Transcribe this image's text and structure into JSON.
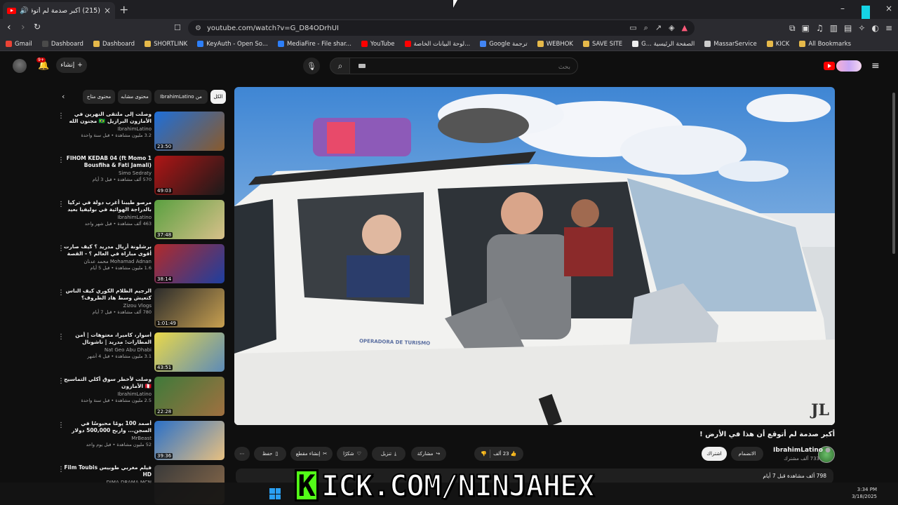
{
  "browser": {
    "tab_title": "(215) أكبر صدمة لم أتوقع أن هـ",
    "url": "youtube.com/watch?v=G_D84ODrhUI",
    "bookmarks": [
      "Gmail",
      "Dashboard",
      "Dashboard",
      "SHORTLINK",
      "KeyAuth - Open So...",
      "MediaFire - File shar...",
      "YouTube",
      "لوحة البيانات الخاصة...",
      "Google ترجمة",
      "WEBHOK",
      "SAVE SITE",
      "G... الصفحة الرئيسية",
      "MassarService",
      "KICK",
      "All Bookmarks"
    ],
    "bookmark_colors": [
      "#ea4335",
      "#4a4a4a",
      "#e6b94a",
      "#e6b94a",
      "#2d7ff9",
      "#2d7ff9",
      "#ff0000",
      "#ff0000",
      "#4285f4",
      "#e6b94a",
      "#e6b94a",
      "#eeeeee",
      "#cccccc",
      "#e6b94a",
      "#e6b94a"
    ]
  },
  "header": {
    "search_placeholder": "بحث",
    "create_label": "إنشاء",
    "notif_count": "9+"
  },
  "video": {
    "title": "أكبر صدمة لم أتوقع أن هذا في الأرض !",
    "door_text": "OPERADORA DE TURISMO",
    "watermark": "JL",
    "channel": "IbrahimLatino",
    "subs": "733 ألف مشترك",
    "join": "الانضمام",
    "subscribe": "اشتراك",
    "likes": "23 ألف",
    "share": "مشاركة",
    "download": "تنزيل",
    "thanks": "شكرًا",
    "clip": "إنشاء مقطع",
    "save": "حفظ",
    "views_meta": "798 ألف مشاهدة قبل 7 أيام"
  },
  "chips": [
    "الكل",
    "من IbrahimLatino",
    "محتوى مشابه",
    "محتوى متاح"
  ],
  "recs": [
    {
      "title": "وصلت إلى ملتقى النهرين في الأمازون البرازيل 🇧🇷 مجنون الله",
      "channel": "IbrahimLatino",
      "meta": "3.2 مليون مشاهدة • قبل سنة واحدة",
      "dur": "23:50",
      "c1": "#1e6fd9",
      "c2": "#8a5a2b"
    },
    {
      "title": "1 FIHOM KEDAB 04 (ft Momo Bousfiha & Fati Jamali)",
      "channel": "Simo Sedraty",
      "meta": "570 ألف مشاهدة • قبل 3 أيام",
      "dur": "49:03",
      "c1": "#b01515",
      "c2": "#1a1a1a"
    },
    {
      "title": "مرصو طيبنا أغرب دولة في تركيا بالدراجة الهوائية في بوليفيا بعيد عن البحر 🇧🇴",
      "channel": "IbrahimLatino",
      "meta": "463 ألف مشاهدة • قبل شهر واحد",
      "dur": "37:48",
      "c1": "#5aa040",
      "c2": "#d8c08a"
    },
    {
      "title": "برشلونة أريال مدريد ؟ كيف صارت أقوى مباراة في العالم ؟ - القصة الكاملة",
      "channel": "Mohamad Adnan محمد عدنان",
      "meta": "1.6 مليون مشاهدة • قبل 5 أيام",
      "dur": "38:14",
      "c1": "#b22a2a",
      "c2": "#1d3fa0"
    },
    {
      "title": "الرجيم الظلام الكوري كيف الناس كتعيش وسط هاد الظروف؟",
      "channel": "Zizou Vlogs",
      "meta": "780 ألف مشاهدة • قبل 7 أيام",
      "dur": "1:01:49",
      "c1": "#2b2b2b",
      "c2": "#c8a050"
    },
    {
      "title": "أسوار، كاميرا، معتوهات | أمن المطارات: مدريد | ناشونال جيوغرافيك أبوظبي",
      "channel": "Nat Geo Abu Dhabi",
      "meta": "3.1 مليون مشاهدة • قبل 4 أشهر",
      "dur": "43:51",
      "c1": "#e9d84a",
      "c2": "#5c8bb8"
    },
    {
      "title": "وصلت لأخطر سوق أكلي التماسيح 🇵🇪 الأمازون",
      "channel": "IbrahimLatino",
      "meta": "2.5 مليون مشاهدة • قبل سنة واحدة",
      "dur": "22:28",
      "c1": "#3f7a3a",
      "c2": "#a07040"
    },
    {
      "title": "أصمد 100 يومًا محبوسًا في السجن... واربح 500,000 دولار",
      "channel": "MrBeast",
      "meta": "52 مليون مشاهدة • قبل يوم واحد",
      "dur": "39:36",
      "c1": "#2a70c8",
      "c2": "#e8c080"
    },
    {
      "title": "فيلم مغربي طوبيس Film Toubis HD",
      "channel": "DIMA DRAMA MCN",
      "meta": "",
      "dur": "",
      "c1": "#3a3a3a",
      "c2": "#8a6a4a"
    }
  ],
  "overlay": {
    "kick_text": "ICK.COM/NINJAHEX",
    "kick_k": "K",
    "clock_time": "3:34 PM",
    "clock_date": "3/18/2025"
  }
}
